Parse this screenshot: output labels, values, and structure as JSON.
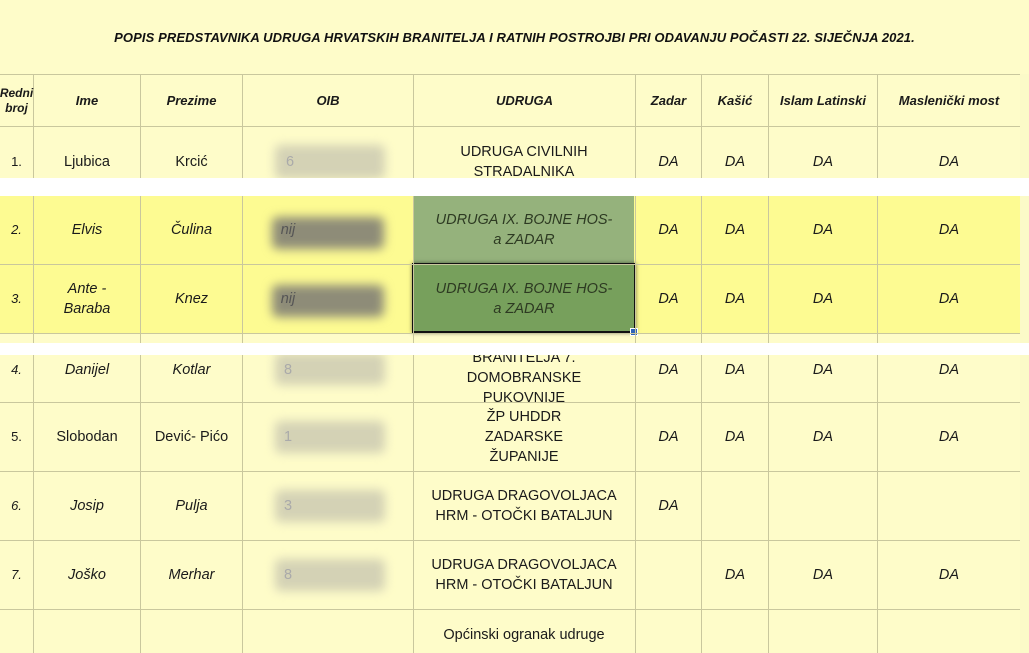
{
  "title": "POPIS PREDSTAVNIKA UDRUGA HRVATSKIH BRANITELJA I RATNIH POSTROJBI PRI ODAVANJU POČASTI 22. SIJEČNJA 2021.",
  "headers": {
    "redni_broj": "Redni broj",
    "ime": "Ime",
    "prezime": "Prezime",
    "oib": "OIB",
    "udruga": "UDRUGA",
    "zadar": "Zadar",
    "kasic": "Kašić",
    "islam": "Islam Latinski",
    "maslenicki": "Maslenički most"
  },
  "rows": [
    {
      "num": "1.",
      "ime": "Ljubica",
      "prezime": "Krcić",
      "oib_visible": "6",
      "udruga": "UDRUGA CIVILNIH STRADALNIKA",
      "zadar": "DA",
      "kasic": "DA",
      "islam": "DA",
      "most": "DA"
    },
    {
      "num": "2.",
      "ime": "Elvis",
      "prezime": "Čulina",
      "oib_visible": "nij",
      "udruga": "UDRUGA IX. BOJNE HOS-a ZADAR",
      "zadar": "DA",
      "kasic": "DA",
      "islam": "DA",
      "most": "DA"
    },
    {
      "num": "3.",
      "ime": "Ante - Baraba",
      "prezime": "Knez",
      "oib_visible": "nij",
      "udruga": "UDRUGA IX. BOJNE HOS-a ZADAR",
      "zadar": "DA",
      "kasic": "DA",
      "islam": "DA",
      "most": "DA"
    },
    {
      "num": "4.",
      "ime": "Danijel",
      "prezime": "Kotlar",
      "oib_visible": "8",
      "udruga": "BRANITELJA 7. DOMOBRANSKE PUKOVNIJE",
      "zadar": "DA",
      "kasic": "DA",
      "islam": "DA",
      "most": "DA"
    },
    {
      "num": "5.",
      "ime": "Slobodan",
      "prezime": "Dević- Pićo",
      "oib_visible": "1",
      "udruga": "ŽP UHDDR ZADARSKE ŽUPANIJE",
      "zadar": "DA",
      "kasic": "DA",
      "islam": "DA",
      "most": "DA"
    },
    {
      "num": "6.",
      "ime": "Josip",
      "prezime": "Pulja",
      "oib_visible": "3",
      "udruga": "UDRUGA DRAGOVOLJACA HRM - OTOČKI BATALJUN",
      "zadar": "DA",
      "kasic": "",
      "islam": "",
      "most": ""
    },
    {
      "num": "7.",
      "ime": "Joško",
      "prezime": "Merhar",
      "oib_visible": "8",
      "udruga": "UDRUGA DRAGOVOLJACA HRM - OTOČKI BATALJUN",
      "zadar": "",
      "kasic": "DA",
      "islam": "DA",
      "most": "DA"
    },
    {
      "num": "",
      "ime": "",
      "prezime": "",
      "oib_visible": "",
      "udruga": "Općinski ogranak udruge",
      "zadar": "",
      "kasic": "",
      "islam": "",
      "most": ""
    }
  ]
}
